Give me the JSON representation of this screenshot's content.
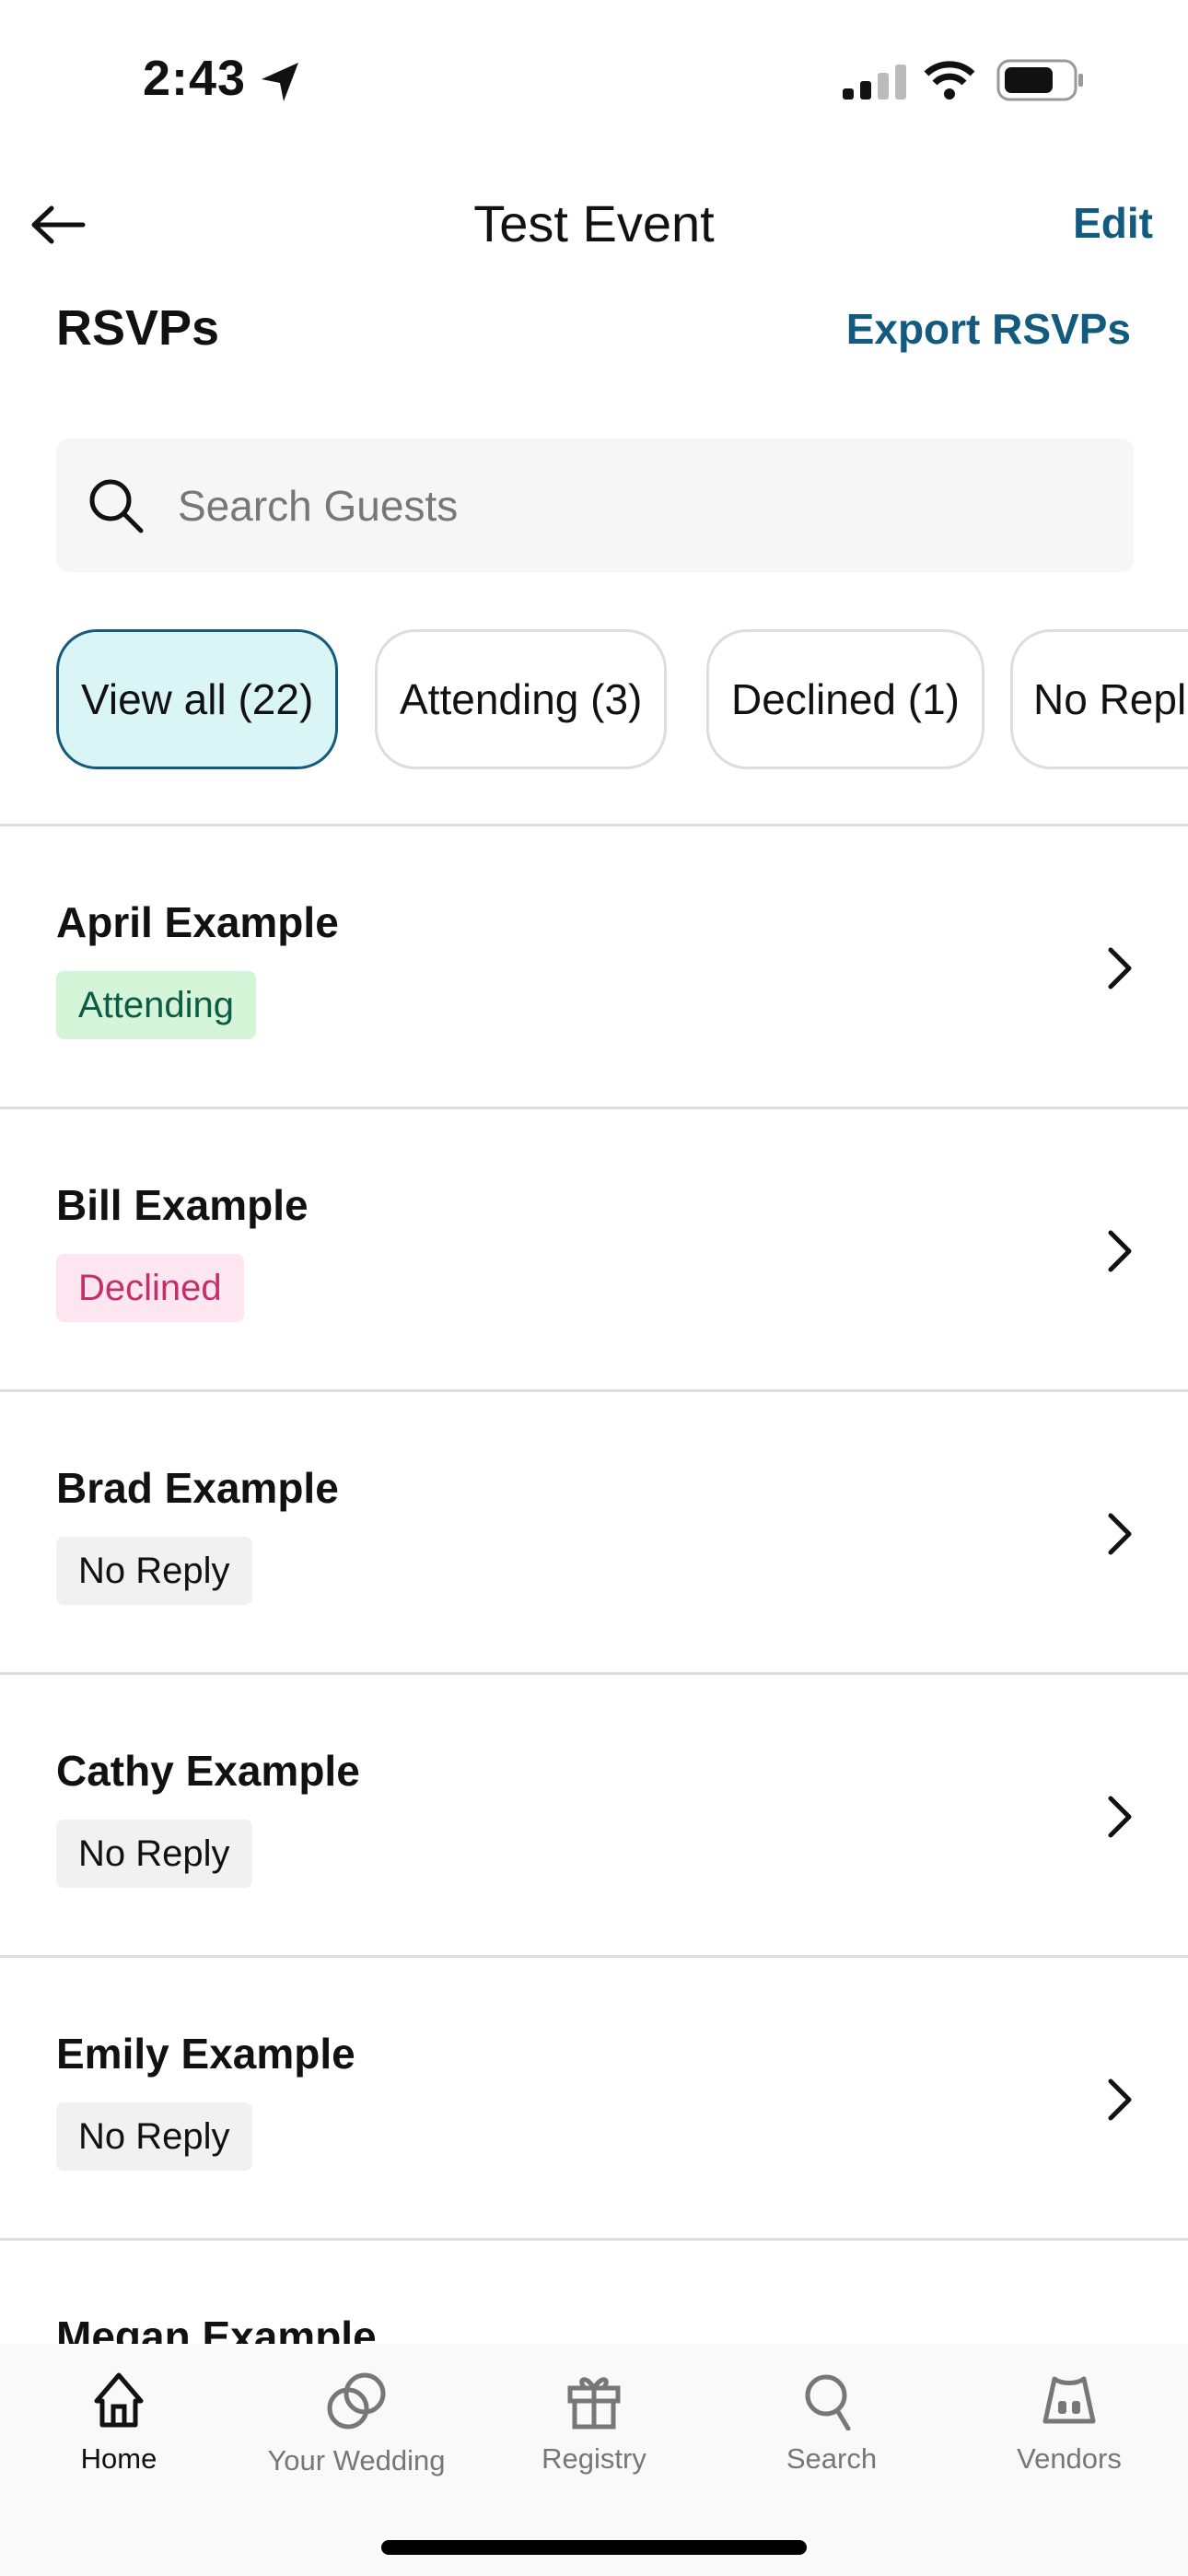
{
  "status_bar": {
    "time": "2:43"
  },
  "header": {
    "title": "Test Event",
    "edit_label": "Edit"
  },
  "section": {
    "title": "RSVPs",
    "export_label": "Export RSVPs"
  },
  "search": {
    "placeholder": "Search Guests",
    "value": ""
  },
  "filters": [
    {
      "label": "View all (22)",
      "active": true
    },
    {
      "label": "Attending (3)",
      "active": false
    },
    {
      "label": "Declined (1)",
      "active": false
    },
    {
      "label": "No Repl",
      "active": false
    }
  ],
  "guests": [
    {
      "name": "April Example",
      "status": "Attending"
    },
    {
      "name": "Bill Example",
      "status": "Declined"
    },
    {
      "name": "Brad Example",
      "status": "No Reply"
    },
    {
      "name": "Cathy Example",
      "status": "No Reply"
    },
    {
      "name": "Emily Example",
      "status": "No Reply"
    },
    {
      "name": "Megan Example",
      "status": ""
    }
  ],
  "status_colors": {
    "Attending": {
      "bg": "#d5f5d9",
      "fg": "#0d5a45"
    },
    "Declined": {
      "bg": "#fde6ef",
      "fg": "#c1306a"
    },
    "No Reply": {
      "bg": "#f1f1f1",
      "fg": "#111111"
    }
  },
  "accent": "#125a7e",
  "tabs": [
    {
      "label": "Home",
      "icon": "home-icon",
      "active": true
    },
    {
      "label": "Your Wedding",
      "icon": "rings-icon",
      "active": false
    },
    {
      "label": "Registry",
      "icon": "gift-icon",
      "active": false
    },
    {
      "label": "Search",
      "icon": "search-icon",
      "active": false
    },
    {
      "label": "Vendors",
      "icon": "vendors-icon",
      "active": false
    }
  ]
}
